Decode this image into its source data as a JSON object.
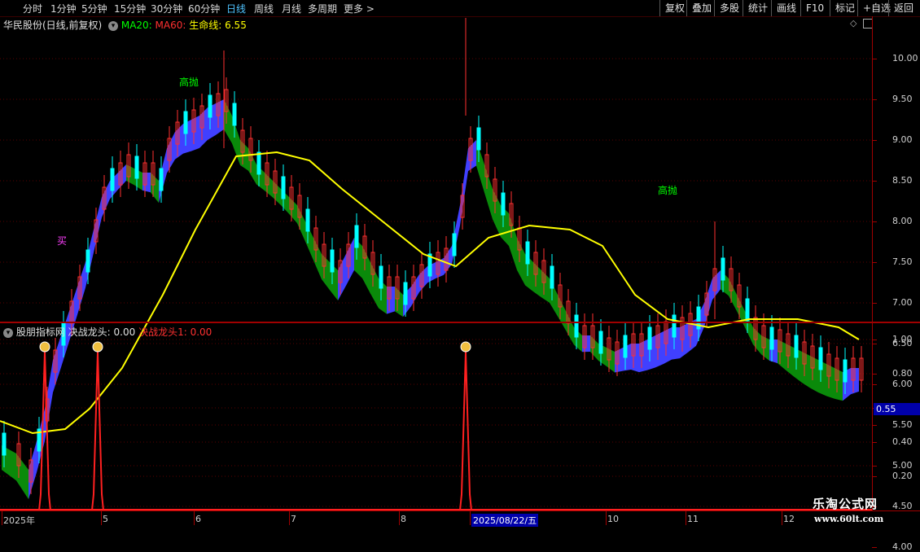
{
  "toolbar": {
    "periods": [
      {
        "label": "分时"
      },
      {
        "label": "1分钟"
      },
      {
        "label": "5分钟"
      },
      {
        "label": "15分钟"
      },
      {
        "label": "30分钟"
      },
      {
        "label": "60分钟"
      },
      {
        "label": "日线",
        "active": true
      },
      {
        "label": "周线"
      },
      {
        "label": "月线"
      },
      {
        "label": "多周期"
      },
      {
        "label": "更多 >"
      }
    ],
    "actions": [
      {
        "label": "复权"
      },
      {
        "label": "叠加"
      },
      {
        "label": "多股"
      },
      {
        "label": "统计"
      },
      {
        "label": "画线"
      },
      {
        "label": "F10"
      },
      {
        "label": "标记"
      },
      {
        "label": "+自选"
      },
      {
        "label": "返回"
      }
    ]
  },
  "main_panel": {
    "title": "华民股份(日线,前复权)",
    "ma20_label": "MA20:",
    "ma60_label": "MA60:",
    "life_line_label": "生命线: 6.55",
    "colors": {
      "ma20": "#00ff00",
      "ma60": "#ff3030",
      "life_line": "#ffff00",
      "up_band": "#4040ff",
      "down_band": "#0a8a0a",
      "candle_up": "#ff3030",
      "candle_down": "#00ffff"
    },
    "annotations": [
      "高抛",
      "高抛",
      "买"
    ],
    "y_axis": [
      "10.00",
      "9.50",
      "9.00",
      "8.50",
      "8.00",
      "7.50",
      "7.00",
      "6.50",
      "6.00",
      "5.50",
      "5.00",
      "4.50",
      "4.00"
    ]
  },
  "sub_panel": {
    "indicator_name": "股朋指标网",
    "value1_label": "决战龙头: 0.00",
    "value2_label": "决战龙头1: 0.00",
    "y_axis": [
      "1.00",
      "0.80",
      "0.60",
      "0.40",
      "0.20"
    ],
    "current_value": "0.55",
    "icon": "money-bag-icon"
  },
  "x_axis": {
    "labels": [
      "2025年",
      "5",
      "6",
      "7",
      "8",
      "2025/08/22/五",
      "10",
      "11",
      "12"
    ]
  },
  "watermark": {
    "line1": "乐淘公式网",
    "line2": "www.60lt.com"
  },
  "chart_data": {
    "type": "candlestick",
    "y_range": [
      3.8,
      10.5
    ],
    "life_line_value": 6.55,
    "signal_peaks": [
      1.0,
      1.0,
      1.0
    ],
    "sub_y_range": [
      0.1,
      1.1
    ]
  }
}
